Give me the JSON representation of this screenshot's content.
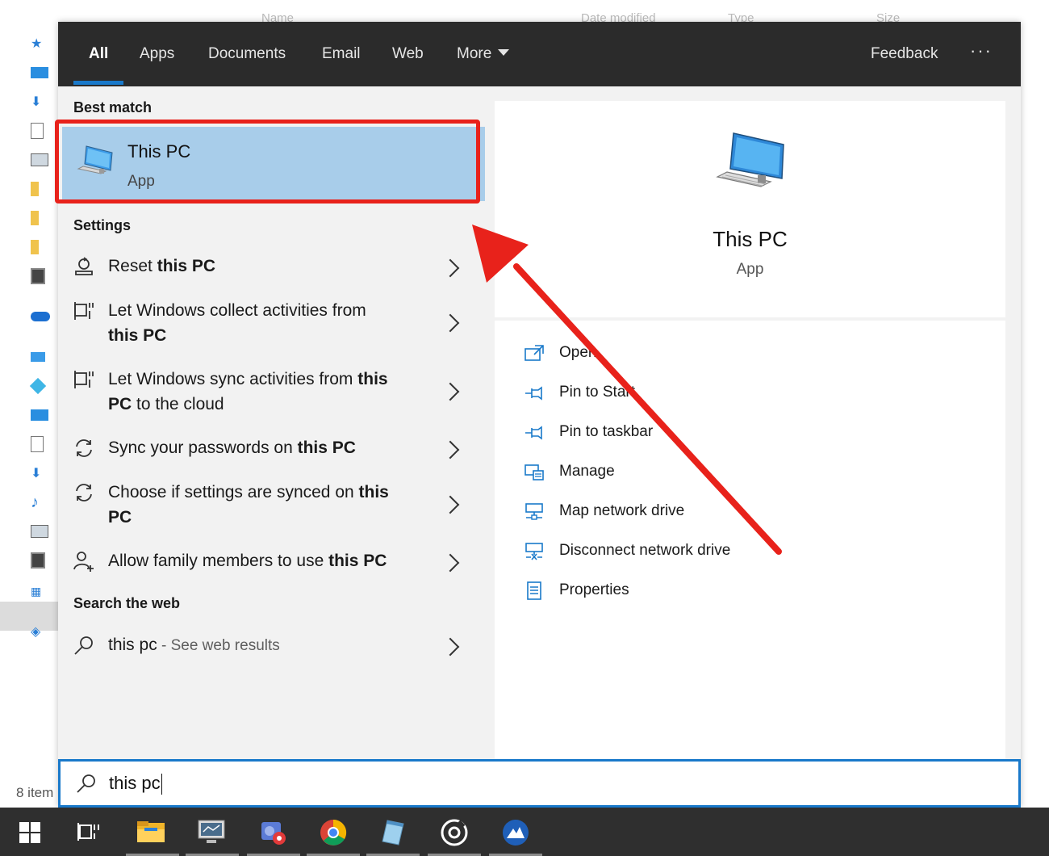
{
  "explorer": {
    "column_headers": [
      "Name",
      "Date modified",
      "Type",
      "Size"
    ],
    "items_count": "8 item"
  },
  "tabs": [
    {
      "label": "All"
    },
    {
      "label": "Apps"
    },
    {
      "label": "Documents"
    },
    {
      "label": "Email"
    },
    {
      "label": "Web"
    },
    {
      "label": "More"
    }
  ],
  "feedback_label": "Feedback",
  "more_options_label": "···",
  "sections": {
    "best_match": "Best match",
    "settings": "Settings",
    "search_web": "Search the web"
  },
  "best_match": {
    "title": "This PC",
    "subtitle": "App"
  },
  "settings_results": [
    {
      "pre": "Reset ",
      "bold": "this PC",
      "post": "",
      "line2": ""
    },
    {
      "pre": "Let Windows collect activities from",
      "bold": "",
      "post": "",
      "line2_bold": "this PC",
      "line2": ""
    },
    {
      "pre": "Let Windows sync activities from ",
      "bold": "this",
      "post": "",
      "line2_bold": "PC",
      "line2": " to the cloud"
    },
    {
      "pre": "Sync your passwords on ",
      "bold": "this PC",
      "post": "",
      "line2": ""
    },
    {
      "pre": "Choose if settings are synced on ",
      "bold": "this",
      "post": "",
      "line2_bold": "PC",
      "line2": ""
    },
    {
      "pre": "Allow family members to use ",
      "bold": "this PC",
      "post": "",
      "line2": ""
    }
  ],
  "web_result": {
    "query": "this pc",
    "suffix": " - See web results"
  },
  "preview": {
    "title": "This PC",
    "subtitle": "App"
  },
  "actions": [
    {
      "label": "Open",
      "icon": "open-icon"
    },
    {
      "label": "Pin to Start",
      "icon": "pin-icon"
    },
    {
      "label": "Pin to taskbar",
      "icon": "pin-icon"
    },
    {
      "label": "Manage",
      "icon": "manage-icon"
    },
    {
      "label": "Map network drive",
      "icon": "map-drive-icon"
    },
    {
      "label": "Disconnect network drive",
      "icon": "disconnect-drive-icon"
    },
    {
      "label": "Properties",
      "icon": "properties-icon"
    }
  ],
  "search": {
    "value": "this pc"
  },
  "taskbar": [
    "windows-start-icon",
    "task-view-icon",
    "file-explorer-icon",
    "remote-desktop-icon",
    "photos-icon",
    "chrome-icon",
    "notepad-icon",
    "media-icon",
    "app-icon"
  ],
  "colors": {
    "accent": "#1979ca",
    "highlight_red": "#e8221b",
    "selection": "#a8cdea",
    "topbar": "#2b2b2b"
  }
}
